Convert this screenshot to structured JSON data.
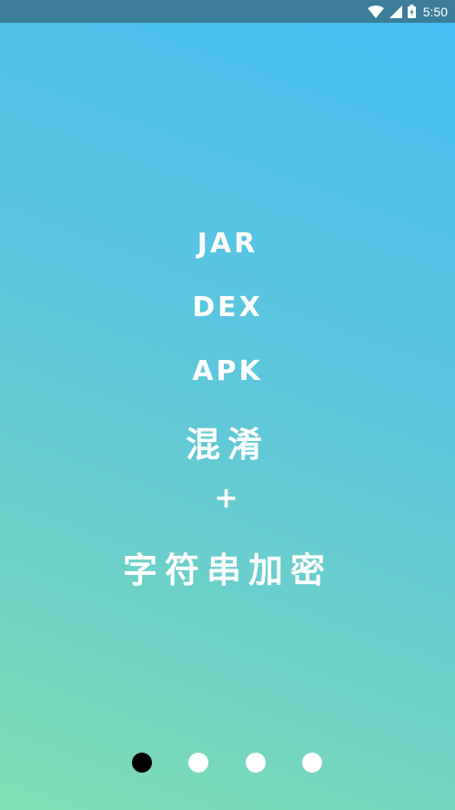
{
  "status_bar": {
    "time": "5:50",
    "icons": [
      "wifi-icon",
      "signal-icon",
      "battery-icon"
    ],
    "background": "#3b7d98"
  },
  "content": {
    "lines": [
      "JAR",
      "DEX",
      "APK",
      "混淆",
      "+",
      "字符串加密"
    ],
    "text_color": "#ffffff"
  },
  "pager": {
    "count": 4,
    "active_index": 0,
    "active_color": "#000000",
    "inactive_color": "#ffffff"
  },
  "background_gradient": [
    "#45bdf3",
    "#80dfb4"
  ]
}
